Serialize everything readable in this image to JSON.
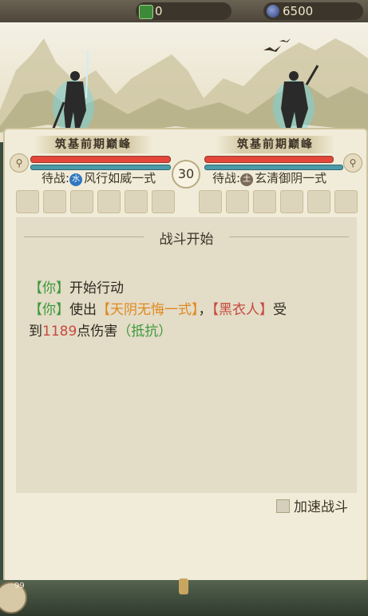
{
  "resources": {
    "jade": "0",
    "spirit_stones": "6500"
  },
  "left_fighter": {
    "realm": "筑基前期巅峰",
    "hp": 1.0,
    "mp": 1.0,
    "standby_label": "待战:",
    "element": "水",
    "skill": "风行如威一式"
  },
  "right_fighter": {
    "realm": "筑基前期巅峰",
    "hp": 0.93,
    "mp": 1.0,
    "standby_label": "待战:",
    "element": "土",
    "skill": "玄清御阴一式"
  },
  "turn_counter": "30",
  "battle_log": {
    "title": "战斗开始",
    "lines": {
      "l1_tag": "【你】",
      "l1_text": "开始行动",
      "l2_tag": "【你】",
      "l2_use": "使出",
      "l2_skill": "【天阴无悔一式】",
      "l2_comma": "，",
      "l2_target": "【黑衣人】",
      "l2_recv": "受",
      "l3_a": "到",
      "l3_dmg": "1189",
      "l3_b": "点伤害",
      "l3_resist": "（抵抗）"
    }
  },
  "speed_toggle": {
    "label": "加速战斗",
    "checked": false
  },
  "corner_count": "99",
  "colors": {
    "hp": "#e5463a",
    "mp": "#4b9aa8",
    "you_tag": "#3c9a3c",
    "skill_name": "#e0891e",
    "enemy_name": "#c64a3e",
    "resist": "#3c9a3c"
  }
}
